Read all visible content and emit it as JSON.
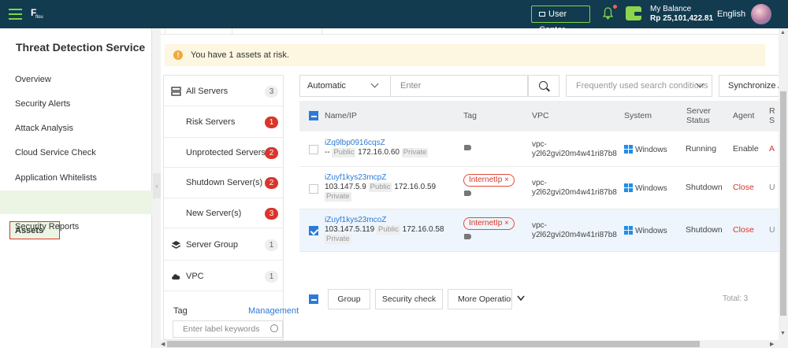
{
  "header": {
    "logo_text": "flou",
    "user_center": "User Center",
    "balance_label": "My Balance",
    "balance_amount": "Rp 25,101,422.81",
    "language": "English"
  },
  "sidebar": {
    "title": "Threat Detection Service",
    "items": [
      {
        "label": "Overview"
      },
      {
        "label": "Security Alerts"
      },
      {
        "label": "Attack Analysis"
      },
      {
        "label": "Cloud Service Check"
      },
      {
        "label": "Application Whitelists"
      },
      {
        "label": "Assets",
        "active": true
      },
      {
        "label": "Security Reports"
      }
    ]
  },
  "alert": {
    "text": "You have 1 assets at risk."
  },
  "server_filter": {
    "items": [
      {
        "label": "All Servers",
        "count": "3"
      },
      {
        "label": "Risk Servers",
        "count": "1"
      },
      {
        "label": "Unprotected Servers",
        "count": "2"
      },
      {
        "label": "Shutdown Server(s)",
        "count": "2"
      },
      {
        "label": "New Server(s)",
        "count": "3"
      },
      {
        "label": "Server Group",
        "count": "1"
      },
      {
        "label": "VPC",
        "count": "1"
      }
    ],
    "tag_label": "Tag",
    "tag_management": "Management",
    "tag_placeholder": "Enter label keywords"
  },
  "search": {
    "mode": "Automatic",
    "placeholder": "Enter",
    "frequent": "Frequently used search conditions",
    "sync": "Synchronize A"
  },
  "table": {
    "headers": {
      "name": "Name/IP",
      "tag": "Tag",
      "vpc": "VPC",
      "system": "System",
      "status_1": "Server",
      "status_2": "Status",
      "agent": "Agent",
      "risk_1": "R",
      "risk_2": "S"
    },
    "rows": [
      {
        "name": "iZq9lbp0916cqsZ",
        "public_ip": "--",
        "public_label": "Public",
        "private_ip": "172.16.0.60",
        "private_label": "Private",
        "tag": "",
        "vpc_1": "vpc-",
        "vpc_2": "y2l62gvi20m4w41ri87b8",
        "system": "Windows",
        "status": "Running",
        "agent": "Enable",
        "risk": "A"
      },
      {
        "name": "iZuyf1kys23mcpZ",
        "public_ip": "103.147.5.9",
        "public_label": "Public",
        "private_ip": "172.16.0.59",
        "private_label": "Private",
        "tag": "InternetIp",
        "vpc_1": "vpc-",
        "vpc_2": "y2l62gvi20m4w41ri87b8",
        "system": "Windows",
        "status": "Shutdown",
        "agent": "Close",
        "risk": "U"
      },
      {
        "name": "iZuyf1kys23mcoZ",
        "public_ip": "103.147.5.119",
        "public_label": "Public",
        "private_ip": "172.16.0.58",
        "private_label": "Private",
        "tag": "InternetIp",
        "vpc_1": "vpc-",
        "vpc_2": "y2l62gvi20m4w41ri87b8",
        "system": "Windows",
        "status": "Shutdown",
        "agent": "Close",
        "risk": "U"
      }
    ],
    "footer": {
      "group": "Group",
      "security_check": "Security check",
      "more_operations": "More Operations",
      "total": "Total: 3"
    }
  },
  "colors": {
    "topbar": "#123b4f",
    "accent_green": "#7fd54a",
    "danger_red": "#d9352a",
    "link_blue": "#2d7ad6"
  }
}
